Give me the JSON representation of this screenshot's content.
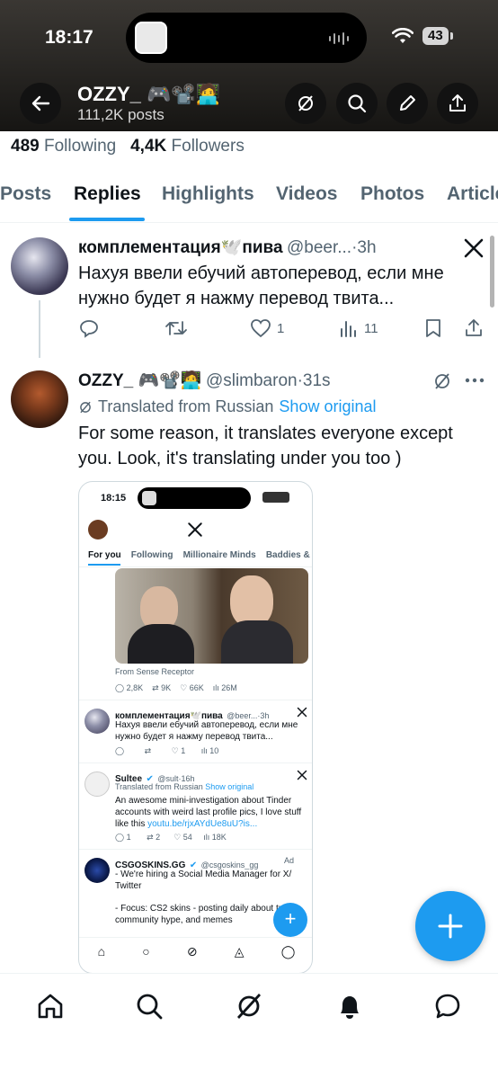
{
  "status": {
    "time": "18:17",
    "battery": "43"
  },
  "header": {
    "name": "OZZY_ 🎮📽️🧑‍💻",
    "posts": "111,2K posts"
  },
  "profile": {
    "following_count": "489",
    "following_label": "Following",
    "followers_count": "4,4K",
    "followers_label": "Followers"
  },
  "tabs": [
    "Posts",
    "Replies",
    "Highlights",
    "Videos",
    "Photos",
    "Articles"
  ],
  "tweet1": {
    "name": "комплементация🕊️пива",
    "handle": "@beer...",
    "time": "·3h",
    "text": "Нахуя ввели ебучий автоперевод, если мне нужно будет я нажму перевод твита...",
    "likes": "1",
    "views": "11"
  },
  "tweet2": {
    "name": "OZZY_ 🎮📽️🧑‍💻",
    "handle": "@slimbaron",
    "time": "·31s",
    "translated": "Translated from Russian",
    "show_original": "Show original",
    "text": "For some reason, it translates everyone except you. Look, it's translating under you too )"
  },
  "embed": {
    "time": "18:15",
    "tabs": [
      "For you",
      "Following",
      "Millionaire Minds",
      "Baddies & B"
    ],
    "video_caption": "From Sense Receptor",
    "video_stats": {
      "replies": "2,8K",
      "retweets": "9K",
      "likes": "66K",
      "views": "26M"
    },
    "tweet_a": {
      "name": "комплементация🕊️пива",
      "handle": "@beer...·3h",
      "text": "Нахуя ввели ебучий автоперевод, если мне нужно будет я нажму перевод твита...",
      "likes": "1",
      "views": "10"
    },
    "tweet_b": {
      "name": "Sultee",
      "handle": "@sult·16h",
      "translated": "Translated from Russian",
      "show_original": "Show original",
      "text": "An awesome mini-investigation about Tinder accounts with weird last profile pics, I love stuff like this ",
      "link": "youtu.be/rjxAYdUe8uU?is...",
      "replies": "1",
      "retweets": "2",
      "likes": "54",
      "views": "18K"
    },
    "tweet_c": {
      "name": "CSGOSKINS.GG",
      "handle": "@csgoskins_gg",
      "ad": "Ad",
      "line1": "- We're hiring a Social Media Manager for X/ Twitter",
      "line2": "- Focus: CS2 skins - posting daily about trades, community hype, and memes"
    }
  },
  "colors": {
    "accent": "#1d9bf0",
    "text": "#0f1419",
    "muted": "#536471",
    "header_bg": "#2a2825"
  }
}
